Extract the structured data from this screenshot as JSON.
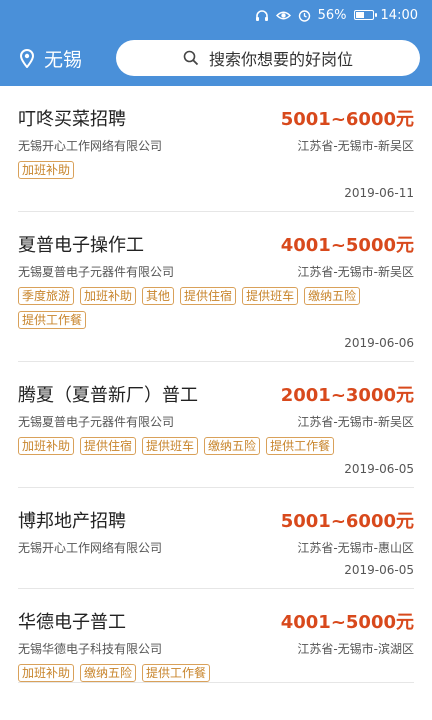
{
  "status_bar": {
    "battery": "56%",
    "battery_level": 0.56,
    "time": "14:00",
    "icons": [
      "headphones-icon",
      "eye-icon",
      "alarm-icon",
      "battery-icon"
    ]
  },
  "header": {
    "city": "无锡",
    "city_icon": "location-pin-icon",
    "search_placeholder": "搜索你想要的好岗位",
    "search_icon": "search-icon",
    "accent_color": "#4a90d9"
  },
  "colors": {
    "salary": "#d8491c",
    "tag": "#c8852c"
  },
  "jobs": [
    {
      "title": "叮咚买菜招聘",
      "salary": "5001~6000元",
      "company": "无锡开心工作网络有限公司",
      "location": "江苏省-无锡市-新吴区",
      "tags": [
        "加班补助"
      ],
      "date": "2019-06-11"
    },
    {
      "title": "夏普电子操作工",
      "salary": "4001~5000元",
      "company": "无锡夏普电子元器件有限公司",
      "location": "江苏省-无锡市-新吴区",
      "tags": [
        "季度旅游",
        "加班补助",
        "其他",
        "提供住宿",
        "提供班车",
        "缴纳五险",
        "提供工作餐"
      ],
      "date": "2019-06-06"
    },
    {
      "title": "腾夏（夏普新厂）普工",
      "salary": "2001~3000元",
      "company": "无锡夏普电子元器件有限公司",
      "location": "江苏省-无锡市-新吴区",
      "tags": [
        "加班补助",
        "提供住宿",
        "提供班车",
        "缴纳五险",
        "提供工作餐"
      ],
      "date": "2019-06-05"
    },
    {
      "title": "博邦地产招聘",
      "salary": "5001~6000元",
      "company": "无锡开心工作网络有限公司",
      "location": "江苏省-无锡市-惠山区",
      "tags": [],
      "date": "2019-06-05"
    },
    {
      "title": "华德电子普工",
      "salary": "4001~5000元",
      "company": "无锡华德电子科技有限公司",
      "location": "江苏省-无锡市-滨湖区",
      "tags": [
        "加班补助",
        "缴纳五险",
        "提供工作餐"
      ],
      "date": ""
    }
  ]
}
